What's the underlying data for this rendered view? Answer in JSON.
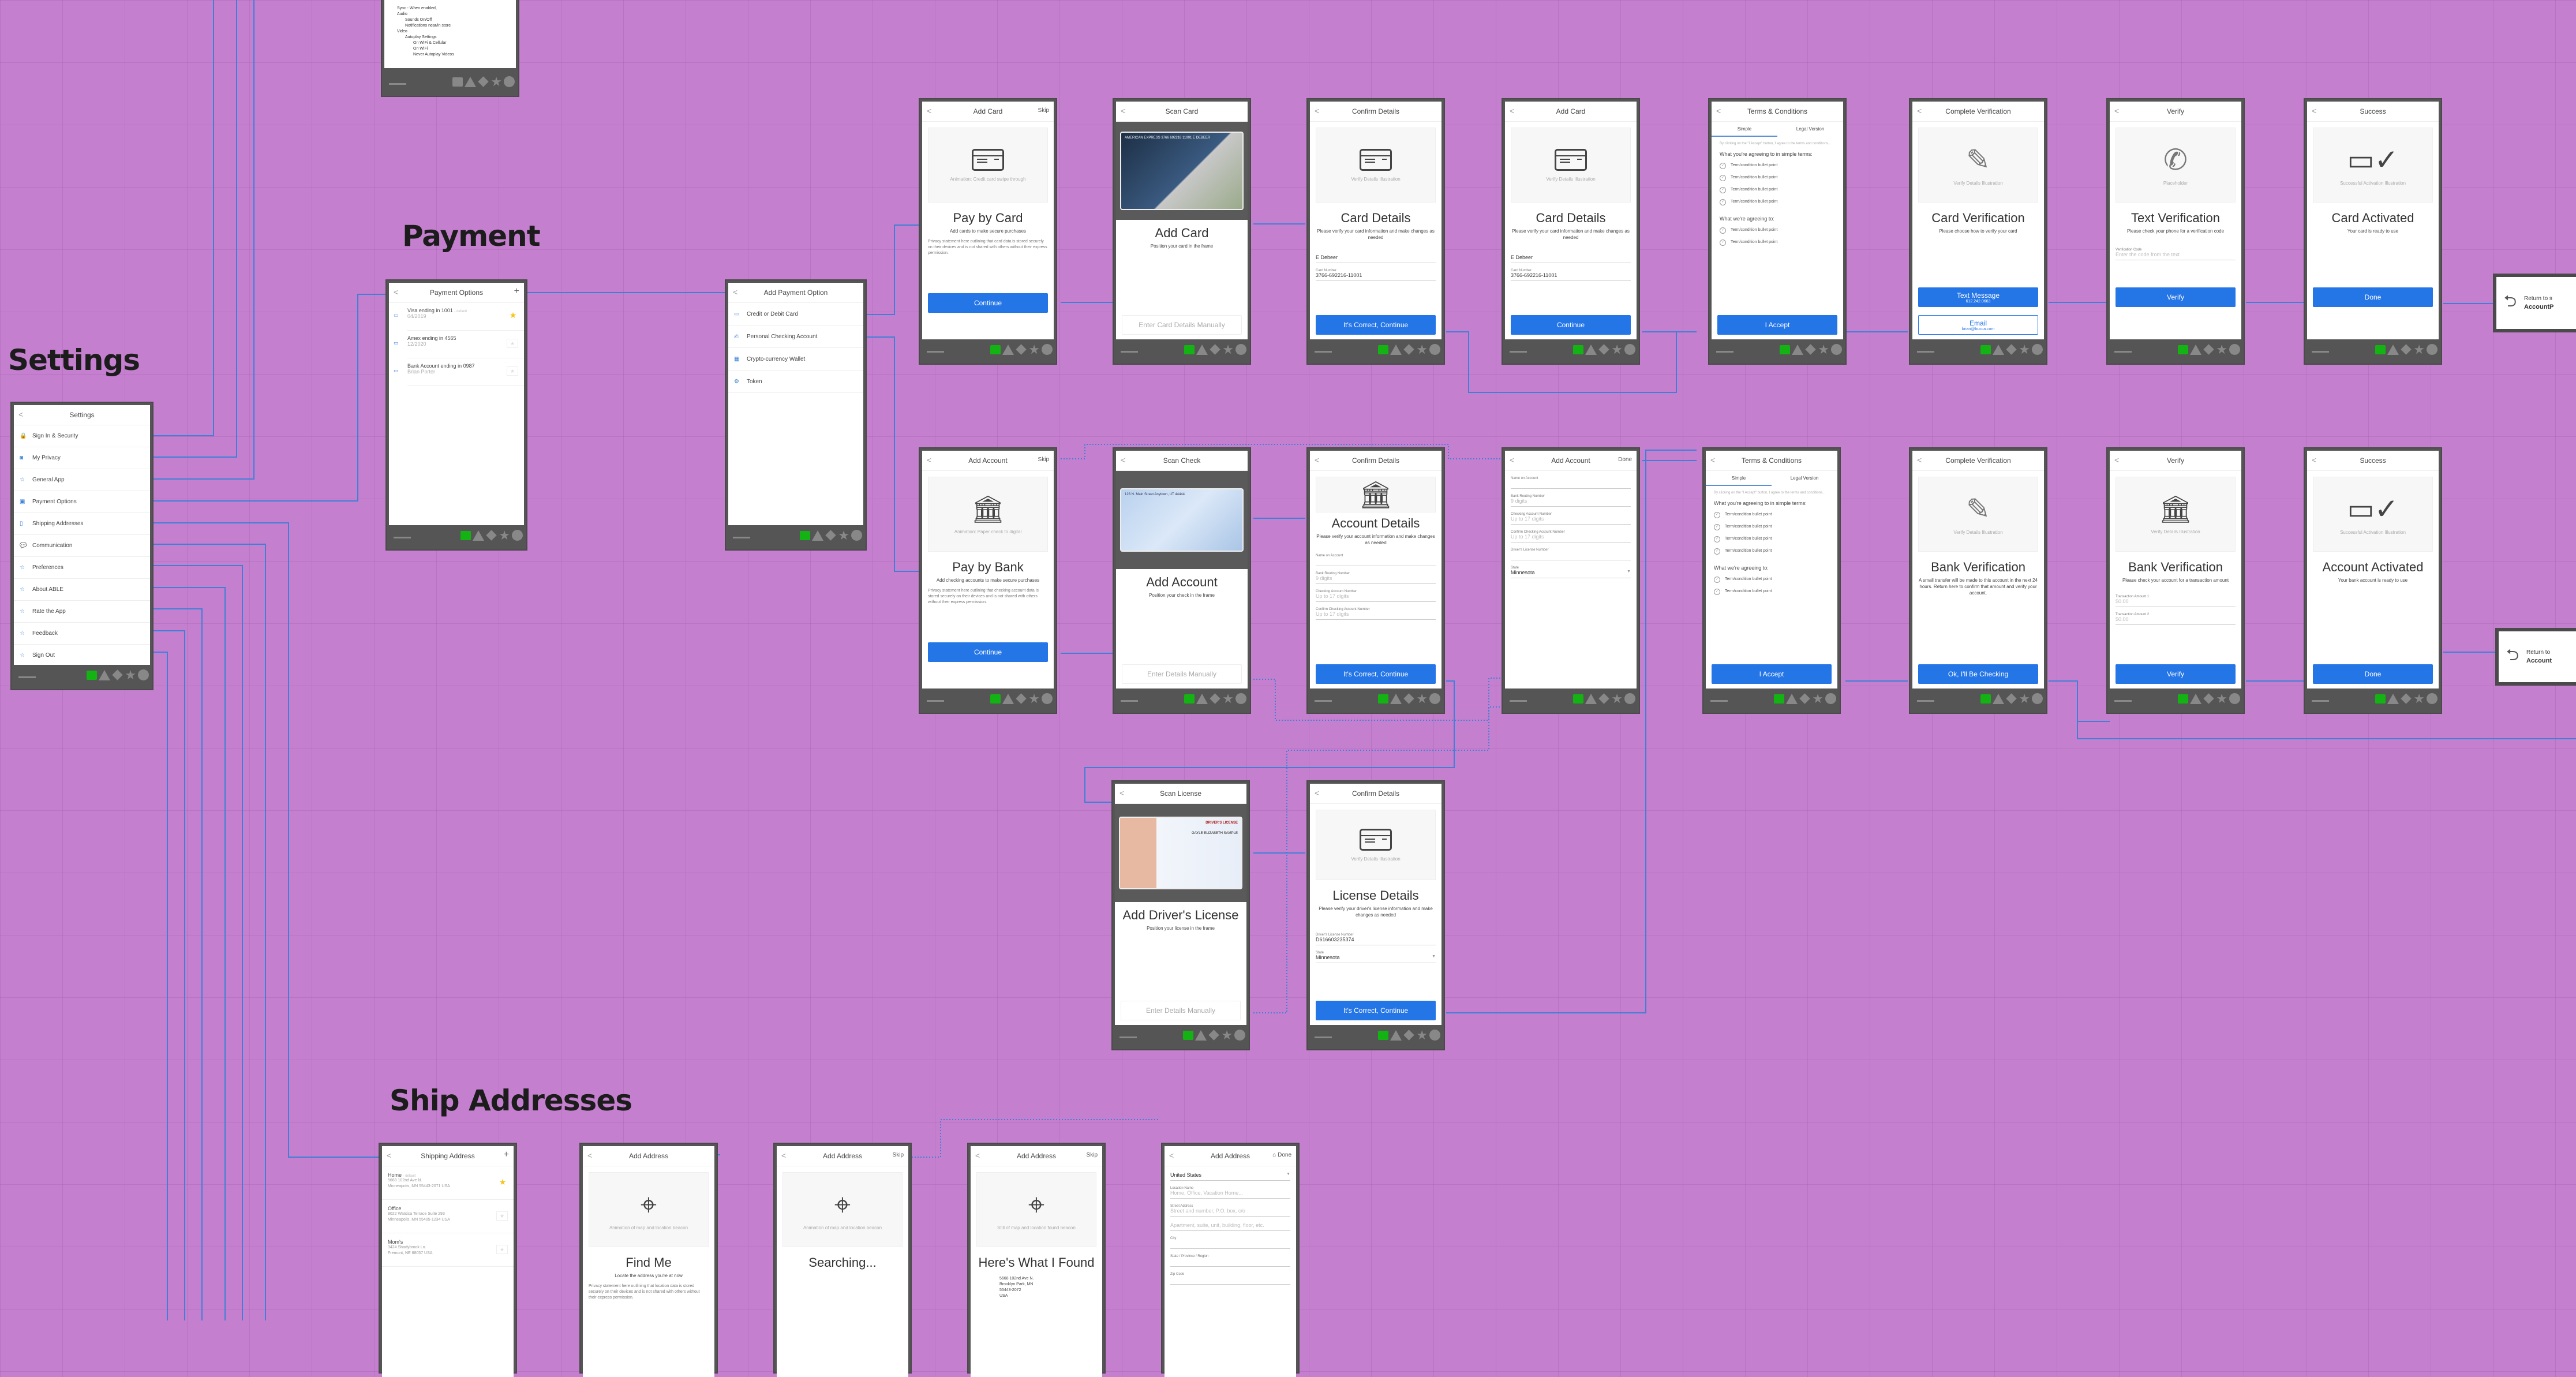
{
  "sections": {
    "settings": "Settings",
    "payment": "Payment",
    "ship_addresses": "Ship Addresses"
  },
  "colors": {
    "canvas": "#c47fce",
    "accent": "#2475e6",
    "connector": "#3f7fd8",
    "frame": "#555555",
    "star": "#f5c518"
  },
  "general_app_fragment": {
    "lines": [
      "Sync - When enabled,",
      "Audio",
      "Sounds On/Off",
      "Notifications near/in store",
      "Video",
      "Autoplay Settings",
      "On WiFi & Cellular",
      "On WiFi",
      "Never Autoplay Videos"
    ]
  },
  "settings_screen": {
    "title": "Settings",
    "items": [
      {
        "label": "Sign In & Security",
        "icon": "lock-icon"
      },
      {
        "label": "My Privacy",
        "icon": "privacy-icon"
      },
      {
        "label": "General App",
        "icon": "star-box-icon"
      },
      {
        "label": "Payment Options",
        "icon": "wallet-icon"
      },
      {
        "label": "Shipping Addresses",
        "icon": "box-icon"
      },
      {
        "label": "Communication",
        "icon": "chat-icon"
      },
      {
        "label": "Preferences",
        "icon": "star-box-icon"
      },
      {
        "label": "About ABLE",
        "icon": "star-box-icon"
      },
      {
        "label": "Rate the App",
        "icon": "star-box-icon"
      },
      {
        "label": "Feedback",
        "icon": "star-box-icon"
      },
      {
        "label": "Sign Out",
        "icon": "star-box-icon"
      }
    ]
  },
  "payment_options": {
    "title": "Payment Options",
    "items": [
      {
        "name": "Visa ending in 1001",
        "tag": "- default",
        "detail": "04/2019",
        "starred": true
      },
      {
        "name": "Amex ending in 4565",
        "tag": "",
        "detail": "12/2020",
        "starred": false
      },
      {
        "name": "Bank Account ending in 0987",
        "tag": "",
        "detail": "Brian Porter",
        "starred": false
      }
    ]
  },
  "add_payment_option": {
    "title": "Add Payment Option",
    "items": [
      "Credit or Debit Card",
      "Personal Checking Account",
      "Crypto-currency Wallet",
      "Token"
    ]
  },
  "card_flow": {
    "add_card": {
      "title": "Add Card",
      "right": "Skip",
      "caption": "Animation: Credit card swipe through",
      "headline": "Pay by Card",
      "sub": "Add cards to make secure purchases",
      "privacy": "Privacy statement here outlining that card data is stored securely on their devices and is not shared with others without their express permission.",
      "button": "Continue"
    },
    "scan_card": {
      "title": "Scan Card",
      "card_text": "AMERICAN EXPRESS  3766 692216 11001  E DEBEER",
      "headline": "Add Card",
      "sub": "Position your card in the frame",
      "button": "Enter Card Details Manually"
    },
    "confirm": {
      "title": "Confirm Details",
      "caption": "Verify Details Illustration",
      "headline": "Card Details",
      "sub": "Please verify your card information and make changes as needed",
      "name_value": "E Debeer",
      "number_label": "Card Number",
      "number_value": "3766-692216-11001",
      "button": "It's Correct, Continue"
    },
    "manual": {
      "title": "Add Card",
      "caption": "Verify Details Illustration",
      "headline": "Card Details",
      "sub": "Please verify your card information and make changes as needed",
      "name_value": "E Debeer",
      "number_label": "Card Number",
      "number_value": "3766-692216-11001",
      "button": "Continue"
    },
    "terms": {
      "title": "Terms & Conditions",
      "tab_simple": "Simple",
      "tab_legal": "Legal Version",
      "intro": "By clicking on the \"I Accept\" button, I agree to the terms and conditions...",
      "h1": "What you're agreeing to in simple terms:",
      "h2": "What we're agreeing to:",
      "bullet": "Term/condition bullet point",
      "button": "I Accept"
    },
    "verification": {
      "title": "Complete Verification",
      "caption": "Verify Details Illustration",
      "headline": "Card Verification",
      "sub": "Please choose how to verify your card",
      "btn1": "Text Message",
      "btn1_sub": "612.242.0663",
      "btn2": "Email",
      "btn2_sub": "brian@bucca.com"
    },
    "verify": {
      "title": "Verify",
      "caption": "Placeholder",
      "headline": "Text Verification",
      "sub": "Please check your phone for a verification code",
      "field_label": "Verification Code",
      "field_placeholder": "Enter the code from the text",
      "button": "Verify"
    },
    "success": {
      "title": "Success",
      "caption": "Successful Activation Illustration",
      "headline": "Card Activated",
      "sub": "Your card is ready to use",
      "button": "Done"
    },
    "return_note": {
      "line1": "Return to s",
      "line2": "AccountP"
    }
  },
  "bank_flow": {
    "add_account": {
      "title": "Add Account",
      "right": "Skip",
      "caption": "Animation: Paper check to digital",
      "headline": "Pay by Bank",
      "sub": "Add checking accounts to make secure purchases",
      "privacy": "Privacy statement here outlining that checking account data is stored securely on their devices and is not shared with others without their express permission.",
      "button": "Continue"
    },
    "scan_check": {
      "title": "Scan Check",
      "check_text": "123 N. Main Street  Anytown, UT 44444",
      "headline": "Add Account",
      "sub": "Position your check in the frame",
      "button": "Enter Details Manually"
    },
    "confirm": {
      "title": "Confirm Details",
      "headline": "Account Details",
      "sub": "Please verify your account information and make changes as needed",
      "fields": [
        {
          "label": "Name on Account",
          "value": "",
          "placeholder": true
        },
        {
          "label": "Bank Routing Number",
          "value": "9 digits",
          "placeholder": true
        },
        {
          "label": "Checking Account Number",
          "value": "Up to 17 digits",
          "placeholder": true
        },
        {
          "label": "Confirm Checking Account Number",
          "value": "Up to 17 digits",
          "placeholder": true
        }
      ],
      "button": "It's Correct, Continue"
    },
    "manual": {
      "title": "Add Account",
      "right": "Done",
      "fields": [
        {
          "label": "Name on Account",
          "value": "",
          "placeholder": true
        },
        {
          "label": "Bank Routing Number",
          "value": "9 digits",
          "placeholder": true
        },
        {
          "label": "Checking Account Number",
          "value": "Up to 17 digits",
          "placeholder": true
        },
        {
          "label": "Confirm Checking Account Number",
          "value": "Up to 17 digits",
          "placeholder": true
        },
        {
          "label": "Driver's License Number",
          "value": "",
          "placeholder": true
        },
        {
          "label": "State",
          "value": "Minnesota",
          "placeholder": false
        }
      ]
    },
    "terms": {
      "title": "Terms & Conditions",
      "tab_simple": "Simple",
      "tab_legal": "Legal Version",
      "intro": "By clicking on the \"I Accept\" button, I agree to the terms and conditions...",
      "h1": "What you're agreeing to in simple terms:",
      "h2": "What we're agreeing to:",
      "bullet": "Term/condition bullet point",
      "button": "I Accept"
    },
    "verification": {
      "title": "Complete Verification",
      "caption": "Verify Details Illustration",
      "headline": "Bank Verification",
      "sub": "A small transfer will be made to this account in the next 24 hours. Return here to confirm that amount and verify your account.",
      "button": "Ok, I'll Be Checking"
    },
    "verify": {
      "title": "Verify",
      "caption": "Verify Details Illustration",
      "headline": "Bank Verification",
      "sub": "Please check your account for a transaction amount",
      "f1_label": "Transaction Amount 1",
      "f1_value": "$0.00",
      "f2_label": "Transaction Amount 2",
      "f2_value": "$0.00",
      "button": "Verify"
    },
    "success": {
      "title": "Success",
      "caption": "Successful Activation Illustration",
      "headline": "Account Activated",
      "sub": "Your bank account is ready to use",
      "button": "Done"
    },
    "return_note": {
      "line1": "Return to",
      "line2": "Account"
    }
  },
  "license_flow": {
    "scan": {
      "title": "Scan License",
      "card_title": "DRIVER'S LICENSE",
      "card_name": "GAYLE ELIZABETH SAMPLE",
      "headline": "Add Driver's License",
      "sub": "Position your license in the frame",
      "button": "Enter Details Manually"
    },
    "confirm": {
      "title": "Confirm Details",
      "caption": "Verify Details Illustration",
      "headline": "License Details",
      "sub": "Please verify your driver's license information and make changes as needed",
      "f1_label": "Driver's License Number",
      "f1_value": "D616603235374",
      "f2_label": "State",
      "f2_value": "Minnesota",
      "button": "It's Correct, Continue"
    }
  },
  "address_flow": {
    "list": {
      "title": "Shipping Address",
      "items": [
        {
          "name": "Home",
          "tag": "- default",
          "line1": "5668 102nd Ave N.",
          "line2": "Minneapolis, MN 55443-2071  USA",
          "starred": true
        },
        {
          "name": "Office",
          "tag": "",
          "line1": "9022 Watsica Terrace Suite 293",
          "line2": "Minneapolis, MN 55405-1234 USA",
          "starred": false
        },
        {
          "name": "Mom's",
          "tag": "",
          "line1": "3424 Shadybrook Ln.",
          "line2": "Fremont, NE 68057 USA",
          "starred": false
        }
      ]
    },
    "find_me": {
      "title": "Add Address",
      "caption": "Animation of map and location beacon",
      "headline": "Find Me",
      "sub": "Locate the address you're at now",
      "privacy": "Privacy statement here outlining that location data is stored securely on their devices and is not shared with others without their express permission."
    },
    "searching": {
      "title": "Add Address",
      "right": "Skip",
      "caption": "Animation of map and location beacon",
      "headline": "Searching..."
    },
    "found": {
      "title": "Add Address",
      "right": "Skip",
      "caption": "Still of map and location found beacon",
      "headline": "Here's What I Found",
      "address": [
        "5668 102nd Ave N.",
        "Brooklyn Park, MN",
        "55443-2072",
        "USA"
      ]
    },
    "manual": {
      "title": "Add Address",
      "right": "Done",
      "country": "United States",
      "fields": [
        {
          "label": "Location Name",
          "value": "Home, Office, Vacation Home..."
        },
        {
          "label": "Street Address",
          "value": "Street and number, P.O. box, c/o"
        },
        {
          "label": "",
          "value": "Apartment, suite, unit, building, floor, etc."
        },
        {
          "label": "City",
          "value": ""
        },
        {
          "label": "State / Province / Region",
          "value": ""
        },
        {
          "label": "Zip Code",
          "value": ""
        }
      ]
    }
  }
}
